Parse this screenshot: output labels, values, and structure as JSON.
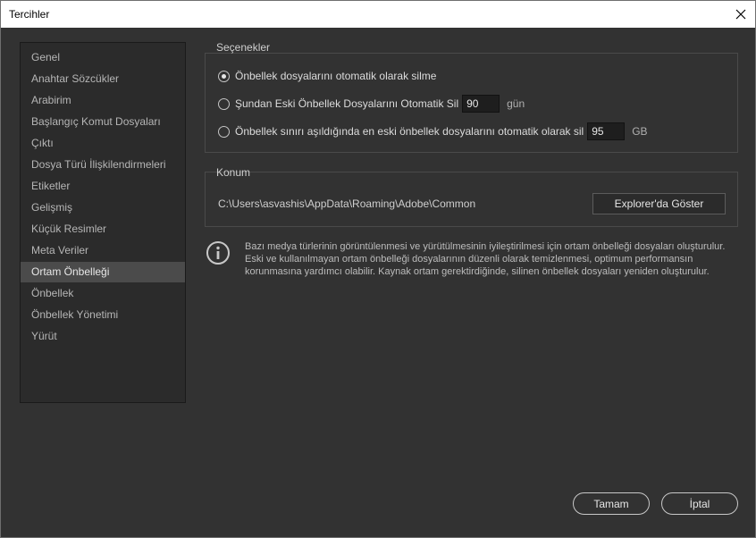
{
  "window": {
    "title": "Tercihler"
  },
  "sidebar": {
    "items": [
      {
        "label": "Genel"
      },
      {
        "label": "Anahtar Sözcükler"
      },
      {
        "label": "Arabirim"
      },
      {
        "label": "Başlangıç Komut Dosyaları"
      },
      {
        "label": "Çıktı"
      },
      {
        "label": "Dosya Türü İlişkilendirmeleri"
      },
      {
        "label": "Etiketler"
      },
      {
        "label": "Gelişmiş"
      },
      {
        "label": "Küçük Resimler"
      },
      {
        "label": "Meta Veriler"
      },
      {
        "label": "Ortam Önbelleği",
        "active": true
      },
      {
        "label": "Önbellek"
      },
      {
        "label": "Önbellek Yönetimi"
      },
      {
        "label": "Yürüt"
      }
    ]
  },
  "options": {
    "label": "Seçenekler",
    "radio1": {
      "label": "Önbellek dosyalarını otomatik olarak silme",
      "checked": true
    },
    "radio2": {
      "label": "Şundan Eski Önbellek Dosyalarını Otomatik Sil",
      "value": "90",
      "unit": "gün",
      "checked": false
    },
    "radio3": {
      "label": "Önbellek sınırı aşıldığında en eski önbellek dosyalarını otomatik olarak sil",
      "value": "95",
      "unit": "GB",
      "checked": false
    }
  },
  "location": {
    "label": "Konum",
    "path": "C:\\Users\\asvashis\\AppData\\Roaming\\Adobe\\Common",
    "show_button": "Explorer'da Göster"
  },
  "info": {
    "icon": "info-icon",
    "text": "Bazı medya türlerinin görüntülenmesi ve yürütülmesinin iyileştirilmesi için ortam önbelleği dosyaları oluşturulur. Eski ve kullanılmayan ortam önbelleği dosyalarının düzenli olarak temizlenmesi, optimum performansın korunmasına yardımcı olabilir. Kaynak ortam gerektirdiğinde, silinen önbellek dosyaları yeniden oluşturulur."
  },
  "footer": {
    "ok": "Tamam",
    "cancel": "İptal"
  },
  "colors": {
    "background": "#323232",
    "panel": "#2b2b2b",
    "selected": "#4b4b4b",
    "titlebar": "#ffffff"
  }
}
